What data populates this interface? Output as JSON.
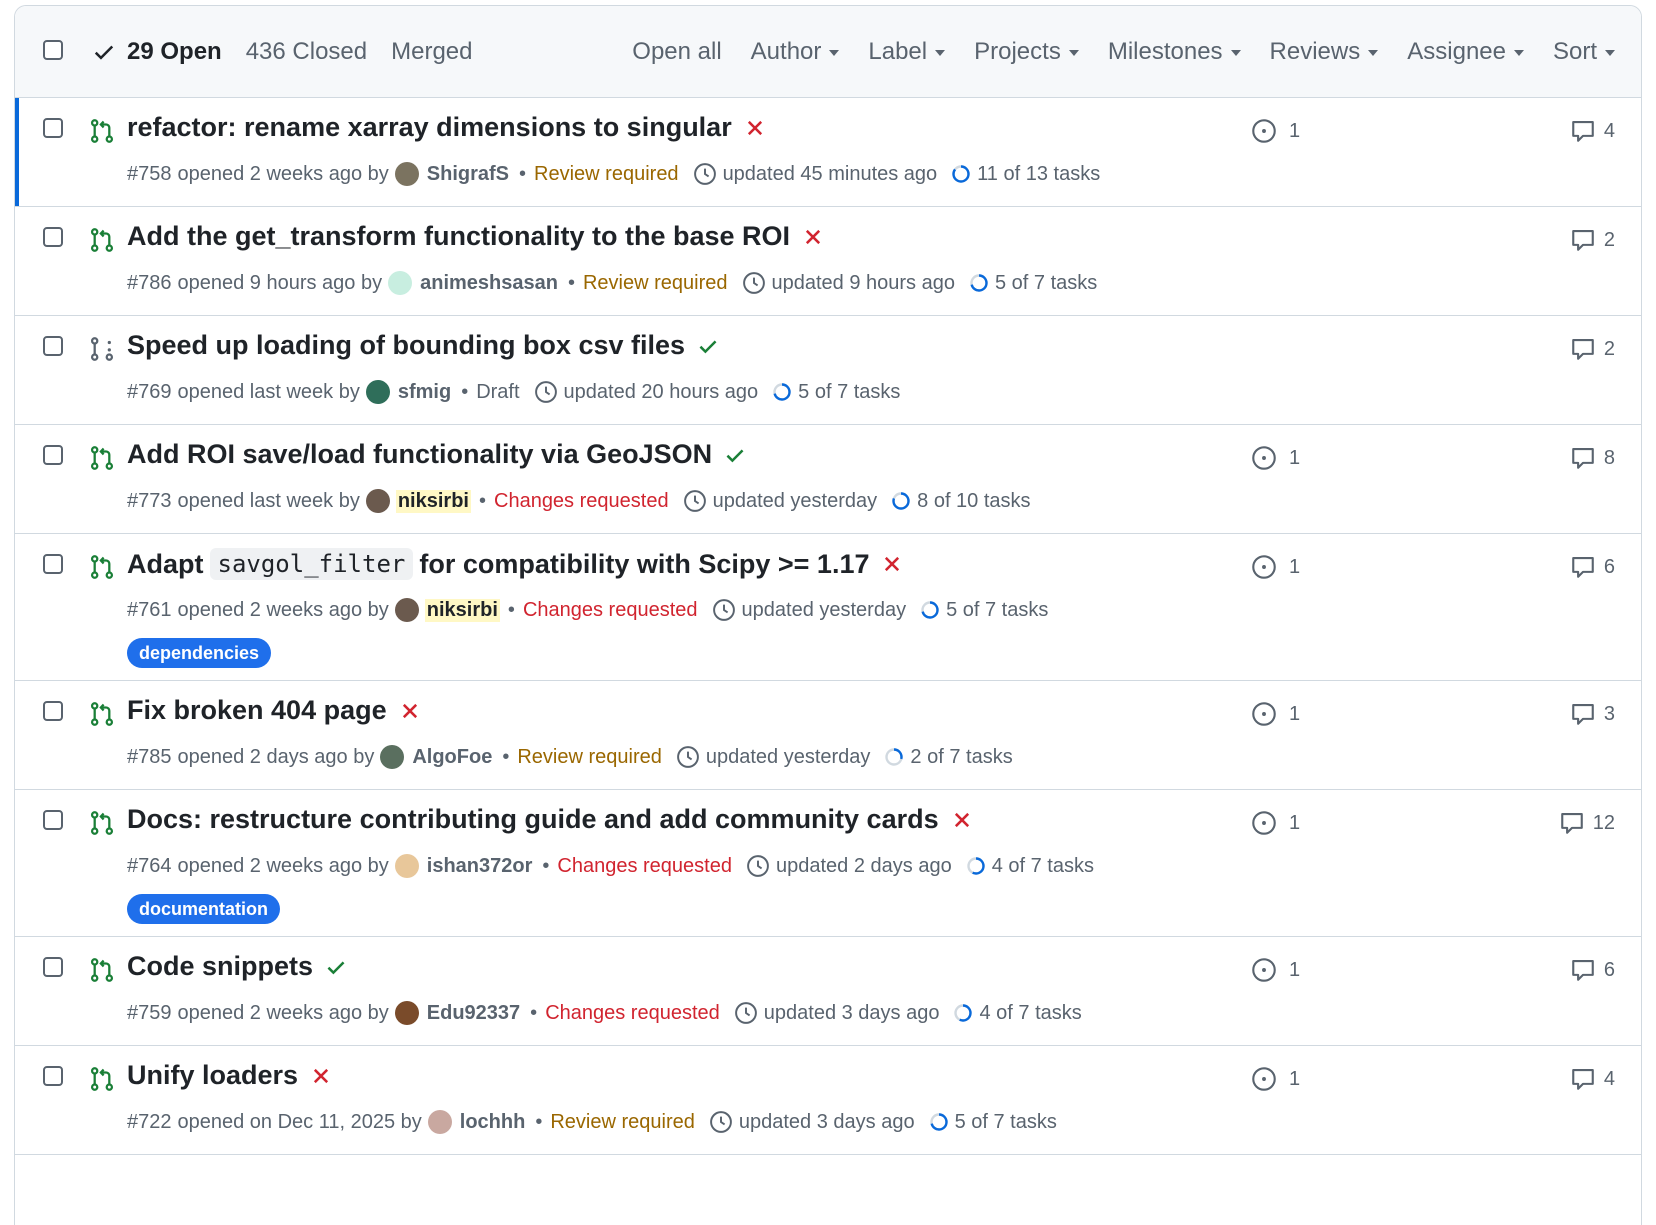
{
  "header": {
    "open_label": "29 Open",
    "closed_label": "436 Closed",
    "merged_label": "Merged",
    "filters": [
      "Open all",
      "Author",
      "Label",
      "Projects",
      "Milestones",
      "Reviews",
      "Assignee",
      "Sort"
    ]
  },
  "colors": {
    "green": "#1a7f37",
    "red": "#d1242f",
    "blue": "#0969da",
    "label_blue": "#1f6feb"
  },
  "prs": [
    {
      "title": "refactor: rename xarray dimensions to singular",
      "status": "fail",
      "draft": false,
      "number": "#758",
      "opened": "opened 2 weeks ago by",
      "author": "ShigrafS",
      "author_highlight": false,
      "review": "Review required",
      "review_type": "req",
      "updated": "updated 45 minutes ago",
      "tasks": "11 of 13 tasks",
      "task_fraction": 0.85,
      "checks": "1",
      "comments": "4",
      "label": null,
      "selected": true,
      "avatar_color": "#7b7360"
    },
    {
      "title": "Add the get_transform functionality to the base ROI",
      "status": "fail",
      "draft": false,
      "number": "#786",
      "opened": "opened 9 hours ago by",
      "author": "animeshsasan",
      "author_highlight": false,
      "review": "Review required",
      "review_type": "req",
      "updated": "updated 9 hours ago",
      "tasks": "5 of 7 tasks",
      "task_fraction": 0.71,
      "checks": null,
      "comments": "2",
      "label": null,
      "selected": false,
      "avatar_color": "#c8eee0"
    },
    {
      "title": "Speed up loading of bounding box csv files",
      "status": "pass",
      "draft": true,
      "number": "#769",
      "opened": "opened last week by",
      "author": "sfmig",
      "author_highlight": false,
      "review": "Draft",
      "review_type": "draft",
      "updated": "updated 20 hours ago",
      "tasks": "5 of 7 tasks",
      "task_fraction": 0.71,
      "checks": null,
      "comments": "2",
      "label": null,
      "selected": false,
      "avatar_color": "#2f6e5a"
    },
    {
      "title": "Add ROI save/load functionality via GeoJSON",
      "status": "pass",
      "draft": false,
      "number": "#773",
      "opened": "opened last week by",
      "author": "niksirbi",
      "author_highlight": true,
      "review": "Changes requested",
      "review_type": "chg",
      "updated": "updated yesterday",
      "tasks": "8 of 10 tasks",
      "task_fraction": 0.8,
      "checks": "1",
      "comments": "8",
      "label": null,
      "selected": false,
      "avatar_color": "#6b5a4e"
    },
    {
      "title_pre": "Adapt",
      "title_code": "savgol_filter",
      "title_post": "for compatibility with Scipy >= 1.17",
      "status": "fail",
      "draft": false,
      "number": "#761",
      "opened": "opened 2 weeks ago by",
      "author": "niksirbi",
      "author_highlight": true,
      "review": "Changes requested",
      "review_type": "chg",
      "updated": "updated yesterday",
      "tasks": "5 of 7 tasks",
      "task_fraction": 0.71,
      "checks": "1",
      "comments": "6",
      "label": "dependencies",
      "selected": false,
      "avatar_color": "#6b5a4e"
    },
    {
      "title": "Fix broken 404 page",
      "status": "fail",
      "draft": false,
      "number": "#785",
      "opened": "opened 2 days ago by",
      "author": "AlgoFoe",
      "author_highlight": false,
      "review": "Review required",
      "review_type": "req",
      "updated": "updated yesterday",
      "tasks": "2 of 7 tasks",
      "task_fraction": 0.29,
      "checks": "1",
      "comments": "3",
      "label": null,
      "selected": false,
      "avatar_color": "#5a6f5f"
    },
    {
      "title": "Docs: restructure contributing guide and add community cards",
      "status": "fail",
      "draft": false,
      "number": "#764",
      "opened": "opened 2 weeks ago by",
      "author": "ishan372or",
      "author_highlight": false,
      "review": "Changes requested",
      "review_type": "chg",
      "updated": "updated 2 days ago",
      "tasks": "4 of 7 tasks",
      "task_fraction": 0.57,
      "checks": "1",
      "comments": "12",
      "label": "documentation",
      "selected": false,
      "avatar_color": "#e8c79a"
    },
    {
      "title": "Code snippets",
      "status": "pass",
      "draft": false,
      "number": "#759",
      "opened": "opened 2 weeks ago by",
      "author": "Edu92337",
      "author_highlight": false,
      "review": "Changes requested",
      "review_type": "chg",
      "updated": "updated 3 days ago",
      "tasks": "4 of 7 tasks",
      "task_fraction": 0.57,
      "checks": "1",
      "comments": "6",
      "label": null,
      "selected": false,
      "avatar_color": "#7a4b2a"
    },
    {
      "title": "Unify loaders",
      "status": "fail",
      "draft": false,
      "number": "#722",
      "opened": "opened on Dec 11, 2025 by",
      "author": "lochhh",
      "author_highlight": false,
      "review": "Review required",
      "review_type": "req",
      "updated": "updated 3 days ago",
      "tasks": "5 of 7 tasks",
      "task_fraction": 0.71,
      "checks": "1",
      "comments": "4",
      "label": null,
      "selected": false,
      "avatar_color": "#c9a8a0"
    }
  ]
}
